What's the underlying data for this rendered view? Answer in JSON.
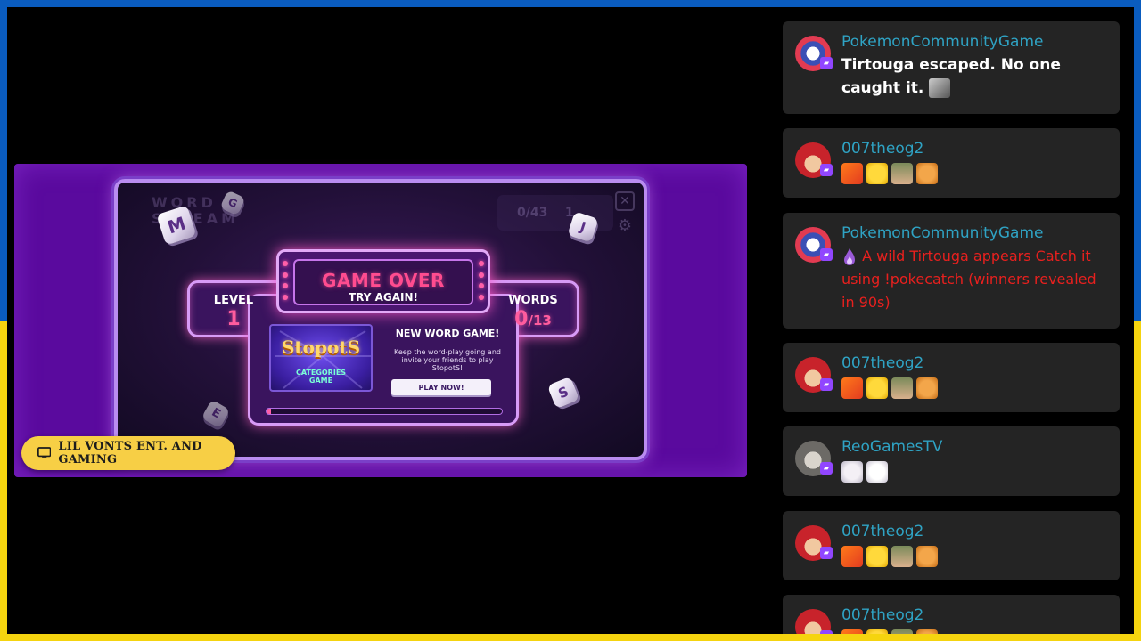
{
  "game": {
    "board_logo": "WORD\nSTREAM",
    "ghost_stats": "0/43    1",
    "dice": [
      "M",
      "J",
      "S",
      "E",
      "G"
    ],
    "title": "GAME OVER",
    "subtitle": "TRY AGAIN!",
    "level_label": "LEVEL",
    "level_value": "1",
    "words_label": "WORDS",
    "words_value": "0",
    "words_total": "/13",
    "promo": {
      "logo": "StopotS",
      "tagline": "CATEGORIES\nGAME",
      "title": "NEW WORD GAME!",
      "description": "Keep the word-play going and invite your friends to play StopotS!",
      "button_label": "PLAY NOW!"
    },
    "progress_fraction": 0.02
  },
  "channel_badge": {
    "icon": "tv-icon",
    "name": "LIL VONTS ENT. AND GAMING"
  },
  "chat": {
    "messages": [
      {
        "username": "PokemonCommunityGame",
        "text": "Tirtouga escaped. No one caught it.",
        "avatar": "pokeball-avatar"
      },
      {
        "username": "007theog2",
        "text": "",
        "avatar": "redhair-avatar"
      },
      {
        "username": "PokemonCommunityGame",
        "text": "A wild Tirtouga appears Catch it using !pokecatch (winners revealed in 90s)",
        "avatar": "pokeball-avatar"
      },
      {
        "username": "007theog2",
        "text": "",
        "avatar": "redhair-avatar"
      },
      {
        "username": "ReoGamesTV",
        "text": "",
        "avatar": "cat-avatar"
      },
      {
        "username": "007theog2",
        "text": "",
        "avatar": "redhair-avatar"
      },
      {
        "username": "007theog2",
        "text": "",
        "avatar": "redhair-avatar"
      }
    ]
  },
  "colors": {
    "border_top": "#0a5cbf",
    "border_bottom": "#f5d40f",
    "username": "#2fa3c4",
    "alert_text": "#e8201e",
    "game_accent": "#ff4c8f",
    "badge_bg": "#f7cf45"
  }
}
